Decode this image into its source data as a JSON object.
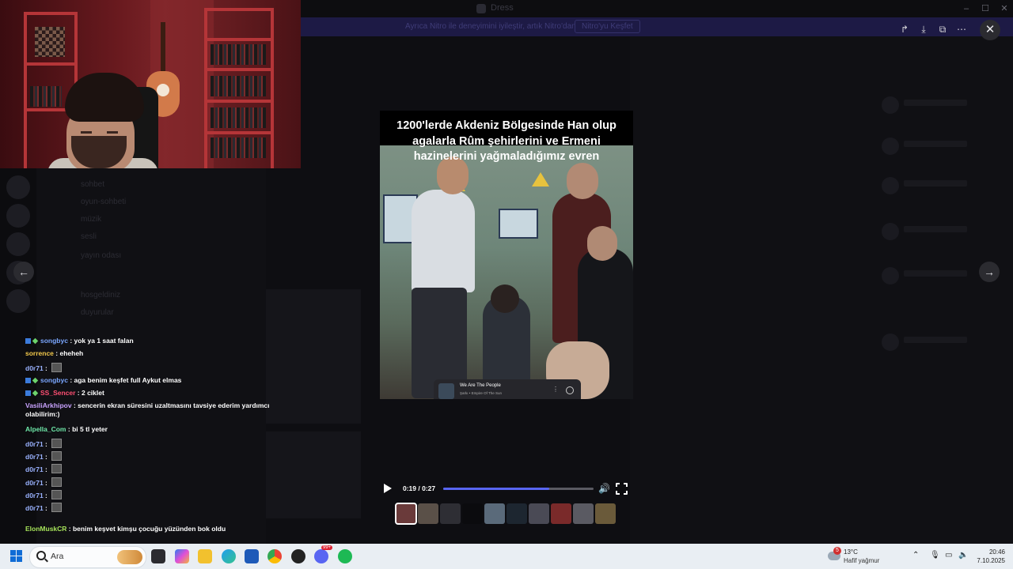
{
  "window": {
    "title": "Dress",
    "controls": [
      "–",
      "☐",
      "✕"
    ]
  },
  "banner": {
    "text": "Ayrıca Nitro ile deneyimini iyileştir, artık Nitro'dan",
    "button": "Nitro'yu Keşfet"
  },
  "sidebar": {
    "channels": [
      "sohbet",
      "oyun-sohbeti",
      "müzik",
      "sesli",
      "yayın odası",
      "hosgeldiniz",
      "duyurular"
    ]
  },
  "viewer": {
    "caption": "1200'lerde Akdeniz Bölgesinde Han olup agalarla Rûm şehirlerini ve Ermeni hazinelerini yağmaladığımız evren",
    "spotify": {
      "title": "We Are The People",
      "subtitle": "Şarkı • Empire Of The Sun"
    },
    "player": {
      "time": "0:19 / 0:27",
      "progress": 0.7037
    },
    "top_actions": [
      "forward-icon",
      "download-icon",
      "open-external-icon",
      "more-icon"
    ],
    "thumbnail_count": 11,
    "selected_thumbnail": 0
  },
  "chat": [
    {
      "user": "songbyc",
      "color": "#7aa6ff",
      "badges": true,
      "text": "yok ya 1 saat falan"
    },
    {
      "user": "sorrence",
      "color": "#f2c84b",
      "badges": false,
      "text": "eheheh"
    },
    {
      "user": "d0r71",
      "color": "#9ab2ff",
      "badges": false,
      "text": "",
      "emote": true
    },
    {
      "user": "songbyc",
      "color": "#7aa6ff",
      "badges": true,
      "text": "aga benim keşfet full Aykut elmas"
    },
    {
      "user": "SS_Sencer",
      "color": "#ff4f73",
      "badges": true,
      "text": "2 ciklet"
    },
    {
      "user": "VasiliArkhipov",
      "color": "#c9a3ff",
      "badges": false,
      "text": "sencerin ekran süresini uzaltmasını tavsiye ederim yardımcı olabilirim:)",
      "wrap": true
    },
    {
      "user": "Alpella_Com",
      "color": "#6ee7a8",
      "badges": false,
      "text": "bi 5 tl yeter"
    },
    {
      "user": "d0r71",
      "color": "#9ab2ff",
      "badges": false,
      "text": "",
      "emote": true
    },
    {
      "user": "d0r71",
      "color": "#9ab2ff",
      "badges": false,
      "text": "",
      "emote": true
    },
    {
      "user": "d0r71",
      "color": "#9ab2ff",
      "badges": false,
      "text": "",
      "emote": true
    },
    {
      "user": "d0r71",
      "color": "#9ab2ff",
      "badges": false,
      "text": "",
      "emote": true
    },
    {
      "user": "d0r71",
      "color": "#9ab2ff",
      "badges": false,
      "text": "",
      "emote": true
    },
    {
      "user": "d0r71",
      "color": "#9ab2ff",
      "badges": false,
      "text": "",
      "emote": true
    },
    {
      "user": "ElonMuskCR",
      "color": "#a6e35a",
      "badges": false,
      "text": "benim keşvet kimşu çocuğu yüzünden bok oldu"
    }
  ],
  "taskbar": {
    "search_placeholder": "Ara",
    "weather": {
      "temp": "13°C",
      "desc": "Hafif yağmur",
      "badge": "5"
    },
    "time": "20:46",
    "date": "7.10.2025",
    "discord_badge": "99+"
  },
  "colors": {
    "accent": "#5865f2",
    "overlay": "#0b0b0e"
  }
}
